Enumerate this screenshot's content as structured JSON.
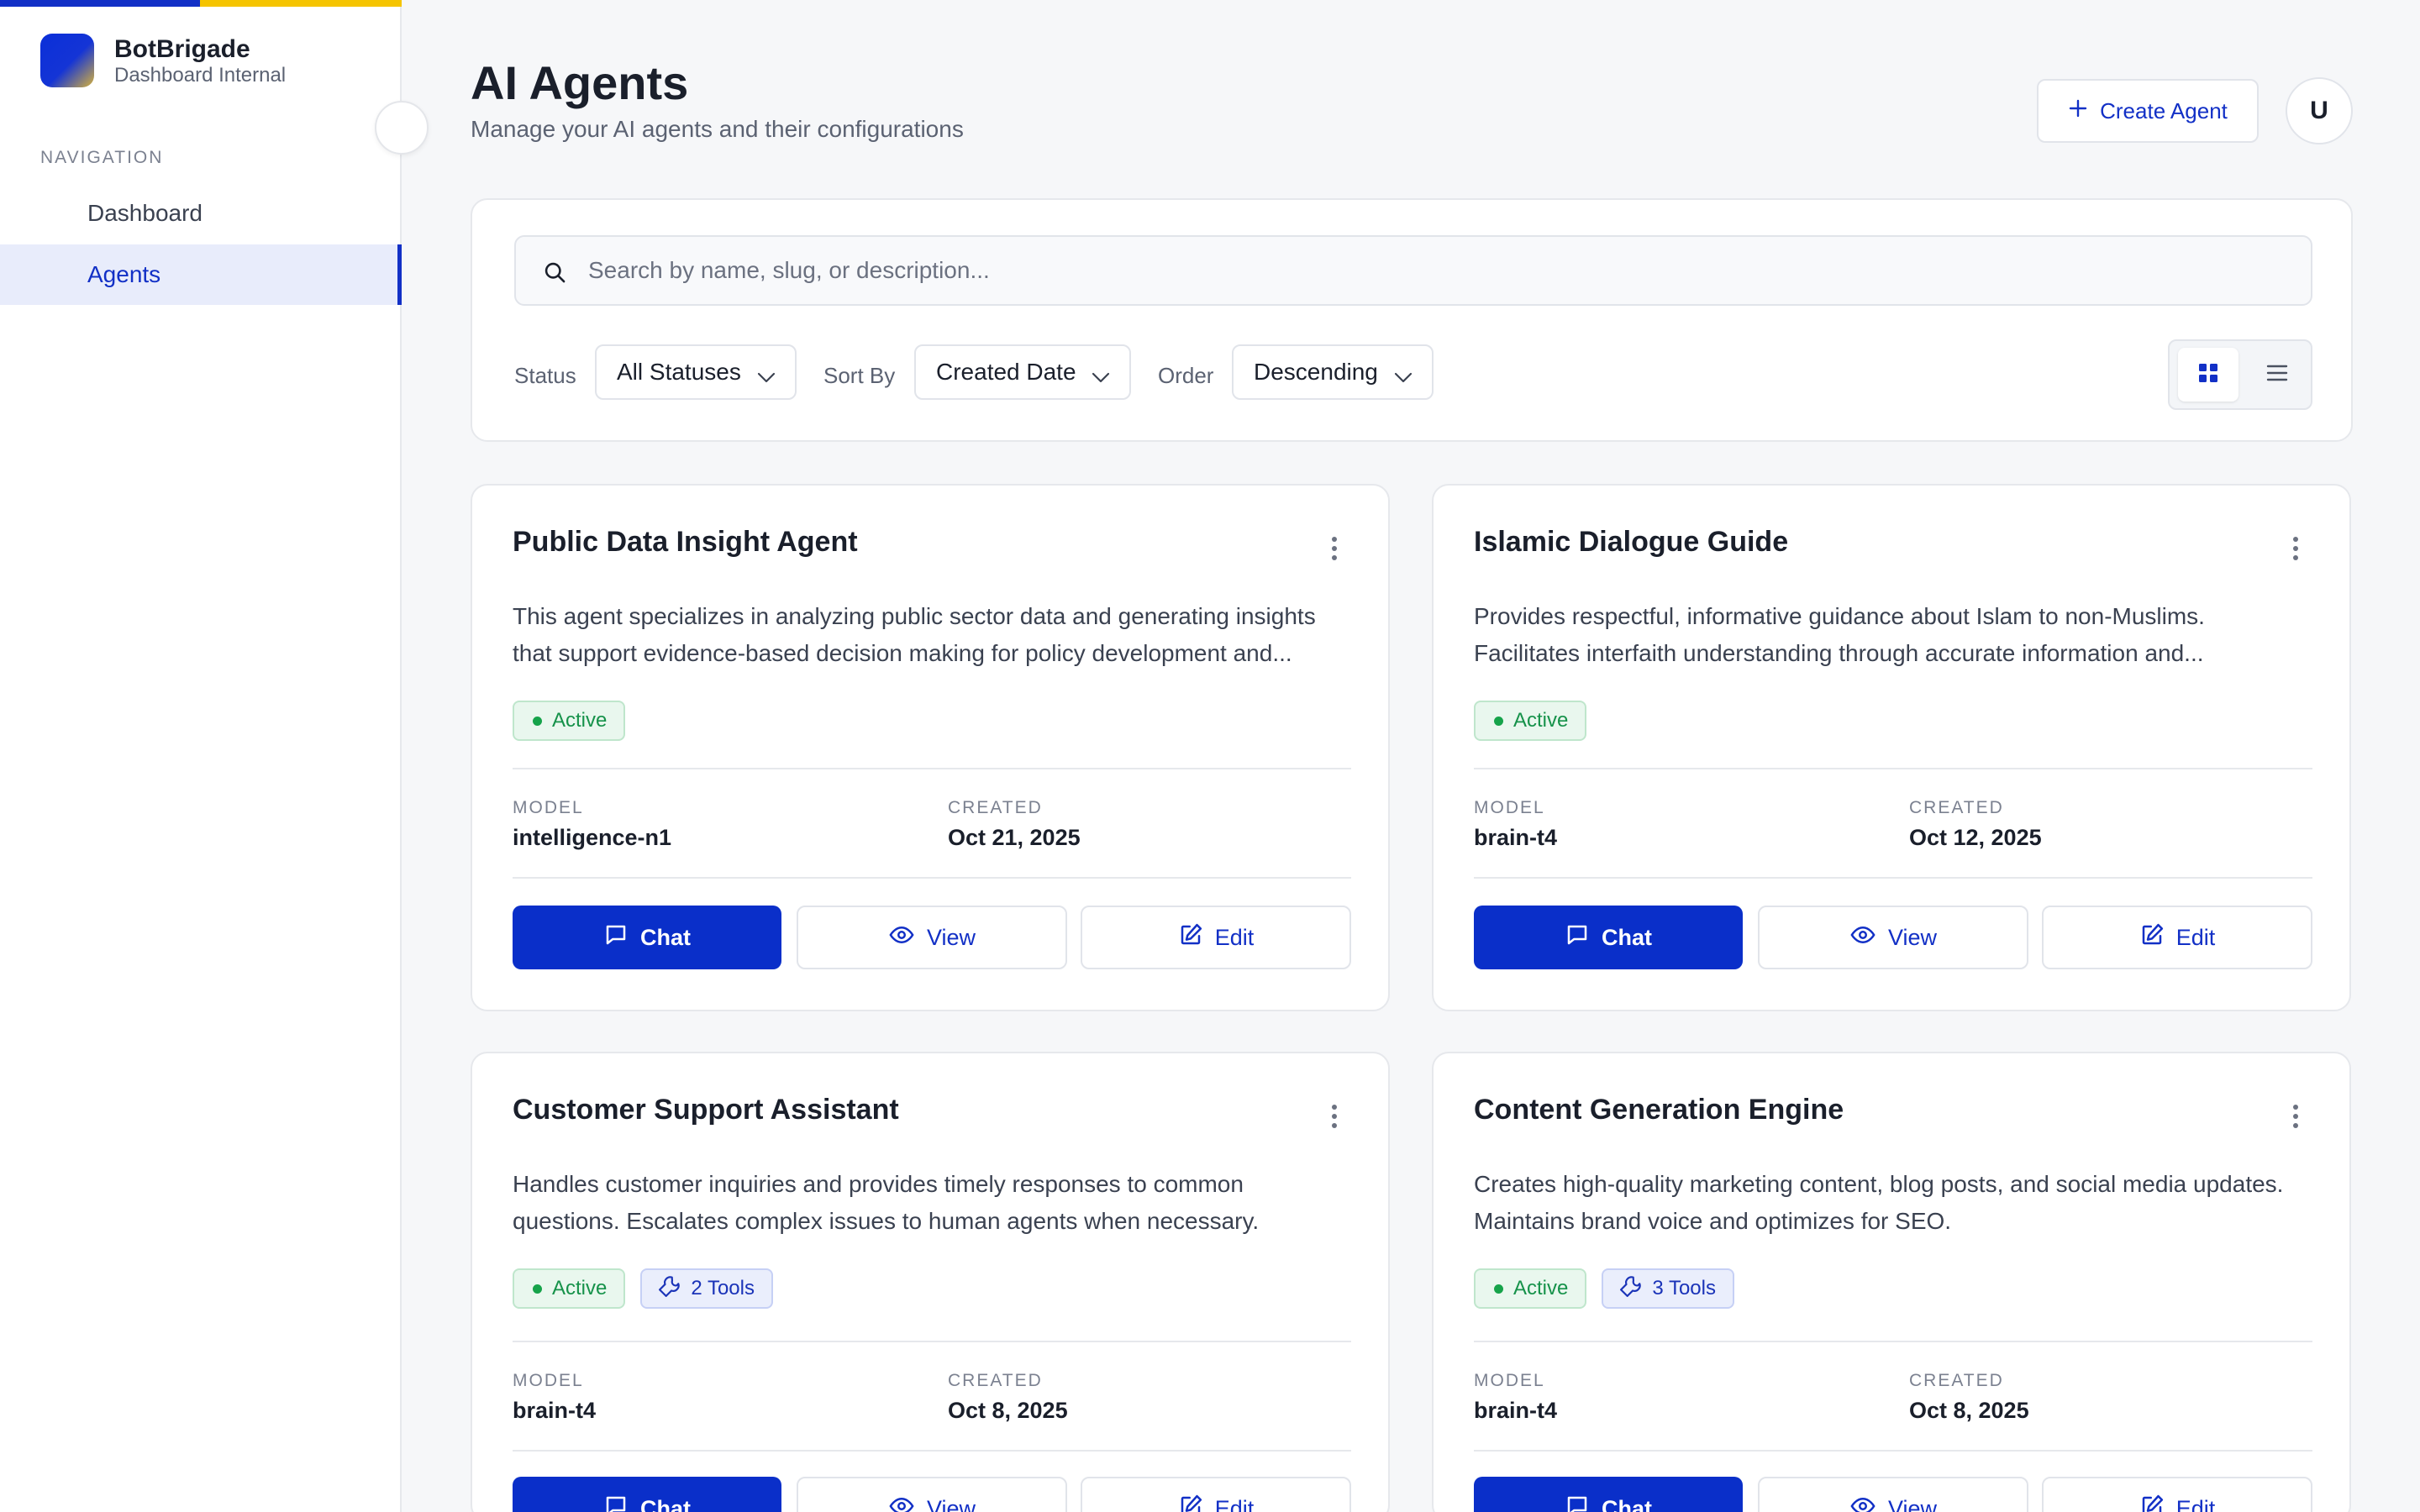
{
  "sidebar": {
    "brand_name": "BotBrigade",
    "brand_sub": "Dashboard Internal",
    "nav_heading": "NAVIGATION",
    "items": [
      {
        "label": "Dashboard"
      },
      {
        "label": "Agents",
        "active": true
      }
    ]
  },
  "header": {
    "title": "AI Agents",
    "subtitle": "Manage your AI agents and their configurations",
    "create_label": "Create Agent",
    "avatar_initial": "U"
  },
  "filters": {
    "search_placeholder": "Search by name, slug, or description...",
    "status_label": "Status",
    "status_value": "All Statuses",
    "sortby_label": "Sort By",
    "sortby_value": "Created Date",
    "order_label": "Order",
    "order_value": "Descending"
  },
  "labels": {
    "model": "MODEL",
    "created": "CREATED",
    "chat": "Chat",
    "view": "View",
    "edit": "Edit"
  },
  "agents": [
    {
      "name": "Public Data Insight Agent",
      "description": "This agent specializes in analyzing public sector data and generating insights that support evidence-based decision making for policy development and...",
      "status": "Active",
      "tools": "",
      "model": "intelligence-n1",
      "created": "Oct 21, 2025"
    },
    {
      "name": "Islamic Dialogue Guide",
      "description": "Provides respectful, informative guidance about Islam to non-Muslims. Facilitates interfaith understanding through accurate information and...",
      "status": "Active",
      "tools": "",
      "model": "brain-t4",
      "created": "Oct 12, 2025"
    },
    {
      "name": "Customer Support Assistant",
      "description": "Handles customer inquiries and provides timely responses to common questions. Escalates complex issues to human agents when necessary.",
      "status": "Active",
      "tools": "2 Tools",
      "model": "brain-t4",
      "created": "Oct 8, 2025"
    },
    {
      "name": "Content Generation Engine",
      "description": "Creates high-quality marketing content, blog posts, and social media updates. Maintains brand voice and optimizes for SEO.",
      "status": "Active",
      "tools": "3 Tools",
      "model": "brain-t4",
      "created": "Oct 8, 2025"
    }
  ],
  "colors": {
    "accent": "#1230c6",
    "brand_yellow": "#f5c400",
    "active_green": "#16924a"
  },
  "icons": [
    "search-icon",
    "plus-icon",
    "chevron-down-icon",
    "grid-icon",
    "list-icon",
    "kebab-icon",
    "chat-icon",
    "eye-icon",
    "edit-icon",
    "wrench-icon"
  ]
}
